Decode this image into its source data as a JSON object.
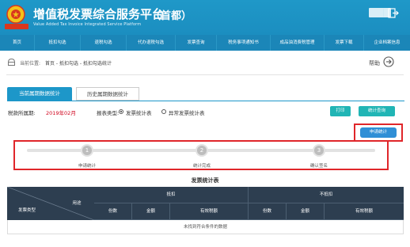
{
  "header": {
    "title": "增值税发票综合服务平台",
    "region": "（首都）",
    "subtitle_en": "Value Added Tax Invoice Integrated Service Platform",
    "emblem_text": "中国税务",
    "colors": {
      "primary": "#1b8ec0",
      "nav": "#1b86b8",
      "accent": "#21b5b5",
      "highlight": "#e0262a",
      "period": "#d0021b"
    }
  },
  "nav": {
    "items": [
      {
        "label": "首页"
      },
      {
        "label": "抵扣勾选"
      },
      {
        "label": "退税勾选"
      },
      {
        "label": "代办退税勾选"
      },
      {
        "label": "发票查询"
      },
      {
        "label": "税务事项通知书"
      },
      {
        "label": "成品油消费税管理"
      },
      {
        "label": "发票下载"
      },
      {
        "label": "企业档案信息"
      }
    ]
  },
  "location": {
    "label": "当前位置:",
    "path": "首页 - 抵扣勾选 - 抵扣勾选统计",
    "help": "帮助"
  },
  "tabs": {
    "current": "当前属期数据统计",
    "history": "历史属期数据统计"
  },
  "filters": {
    "tax_period_label": "税款所属期:",
    "tax_period_value": "2019年02月",
    "report_type_label": "报表类型:",
    "option_invoice": "发票统计表",
    "option_abnormal": "异常发票统计表",
    "print": "打印",
    "stats_query": "统计查询"
  },
  "apply": {
    "label": "申请统计"
  },
  "steps": [
    {
      "number": "1",
      "label": "申请统计"
    },
    {
      "number": "2",
      "label": "统计完成"
    },
    {
      "number": "3",
      "label": "确认签名"
    }
  ],
  "table": {
    "title": "发票统计表",
    "col_invoice_type": "发票类型",
    "col_purpose": "用途",
    "group_deduct": "抵扣",
    "group_non_deduct": "不抵扣",
    "col_count": "份数",
    "col_amount": "金额",
    "col_valid_tax": "有效税额",
    "empty_message": "未找到符合条件的数据"
  }
}
